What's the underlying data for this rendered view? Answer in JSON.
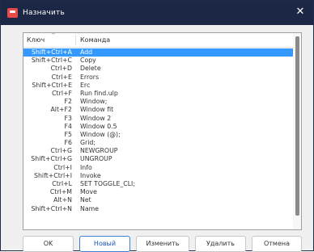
{
  "window": {
    "title": "Назначить"
  },
  "list": {
    "columns": {
      "key": "Ключ",
      "command": "Команда"
    },
    "selected_index": 0,
    "rows": [
      {
        "key": "Shift+Ctrl+A",
        "command": "Add"
      },
      {
        "key": "Shift+Ctrl+C",
        "command": "Copy"
      },
      {
        "key": "Ctrl+D",
        "command": "Delete"
      },
      {
        "key": "Ctrl+E",
        "command": "Errors"
      },
      {
        "key": "Shift+Ctrl+E",
        "command": "Erc"
      },
      {
        "key": "Ctrl+F",
        "command": "Run find.ulp"
      },
      {
        "key": "F2",
        "command": "Window;"
      },
      {
        "key": "Alt+F2",
        "command": "Window fit"
      },
      {
        "key": "F3",
        "command": "Window 2"
      },
      {
        "key": "F4",
        "command": "Window 0.5"
      },
      {
        "key": "F5",
        "command": "Window (@);"
      },
      {
        "key": "F6",
        "command": "Grid;"
      },
      {
        "key": "Ctrl+G",
        "command": "NEWGROUP"
      },
      {
        "key": "Shift+Ctrl+G",
        "command": "UNGROUP"
      },
      {
        "key": "Ctrl+I",
        "command": "Info"
      },
      {
        "key": "Shift+Ctrl+I",
        "command": "Invoke"
      },
      {
        "key": "Ctrl+L",
        "command": "SET TOGGLE_CLI;"
      },
      {
        "key": "Ctrl+M",
        "command": "Move"
      },
      {
        "key": "Alt+N",
        "command": "Net"
      },
      {
        "key": "Shift+Ctrl+N",
        "command": "Name"
      }
    ]
  },
  "buttons": {
    "ok": "OK",
    "new": "Новый",
    "edit": "Изменить",
    "delete": "Удалить",
    "cancel": "Отмена"
  }
}
